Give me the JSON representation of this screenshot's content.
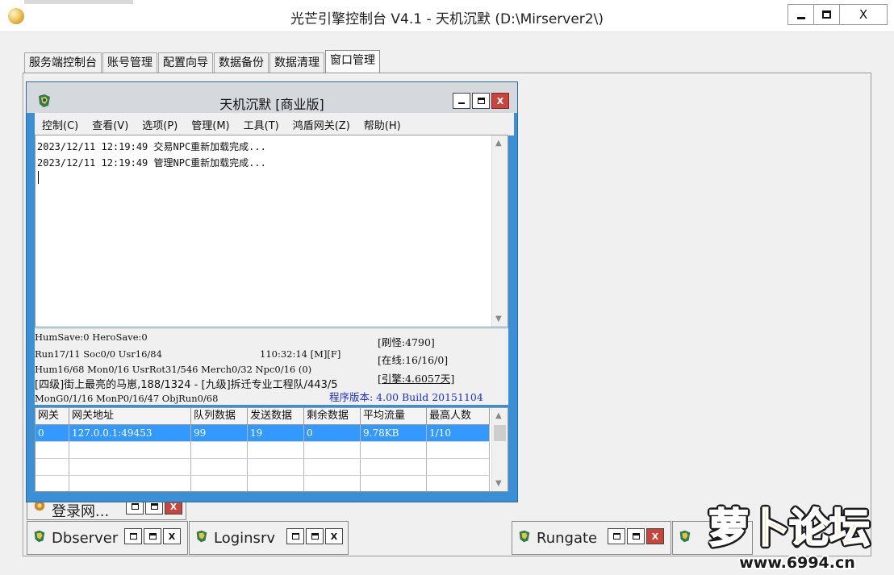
{
  "window": {
    "title": "光芒引擎控制台 V4.1 - 天机沉默 (D:\\Mirserver2\\)",
    "close_glyph": "X"
  },
  "tabs": [
    {
      "label": "服务端控制台",
      "active": false
    },
    {
      "label": "账号管理",
      "active": false
    },
    {
      "label": "配置向导",
      "active": false
    },
    {
      "label": "数据备份",
      "active": false
    },
    {
      "label": "数据清理",
      "active": false
    },
    {
      "label": "窗口管理",
      "active": true
    }
  ],
  "engine": {
    "title": "天机沉默 [商业版]",
    "close_glyph": "X",
    "menu": [
      "控制(C)",
      "查看(V)",
      "选项(P)",
      "管理(M)",
      "工具(T)",
      "鸿盾网关(Z)",
      "帮助(H)"
    ],
    "log": [
      "2023/12/11 12:19:49 交易NPC重新加载完成...",
      "2023/12/11 12:19:49 管理NPC重新加载完成..."
    ],
    "status": {
      "line1": "HumSave:0 HeroSave:0",
      "line2": "Run17/11 Soc0/0 Usr16/84",
      "time": "110:32:14 [M][F]",
      "line3": "Hum16/68 Mon0/16 UsrRot31/546 Merch0/32 Npc0/16 (0)",
      "line4": "[四级]街上最亮的马崽,188/1324 - [九级]拆迁专业工程队/443/5",
      "line5": "MonG0/1/16 MonP0/16/47 ObjRun0/68",
      "refresh": "[刷怪:4790]",
      "online": "[在线:16/16/0]",
      "engine": "[引擎:4.6057天]",
      "version": "程序版本: 4.00 Build 20151104"
    },
    "grid": {
      "columns": [
        "网关",
        "网关地址",
        "队列数据",
        "发送数据",
        "剩余数据",
        "平均流量",
        "最高人数"
      ],
      "rows": [
        [
          "0",
          "127.0.0.1:49453",
          "99",
          "19",
          "0",
          "9.78KB",
          "1/10"
        ]
      ]
    }
  },
  "minimized": [
    {
      "label": "登录网..."
    },
    {
      "label": "Dbserver"
    },
    {
      "label": "Loginsrv"
    },
    {
      "label": "Rungate"
    }
  ],
  "watermark": {
    "brand": "萝卜论坛",
    "url": "www.6994.cn"
  },
  "colors": {
    "selection": "#3399ff",
    "mdi_frame": "#3b8fd4",
    "close_red": "#c8453b",
    "version_blue": "#1a2fd0"
  }
}
